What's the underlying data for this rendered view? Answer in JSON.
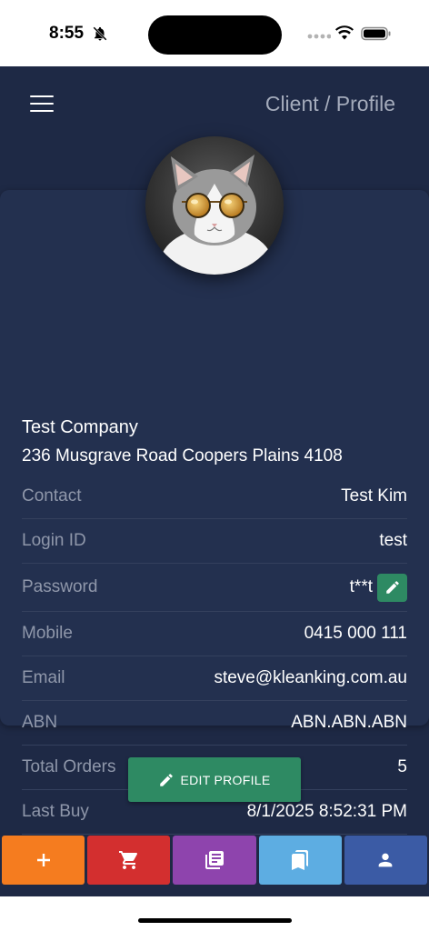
{
  "status_bar": {
    "time": "8:55"
  },
  "header": {
    "title": "Client / Profile"
  },
  "profile": {
    "company": "Test Company",
    "address": "236 Musgrave Road Coopers Plains 4108",
    "fields": [
      {
        "label": "Contact",
        "value": "Test Kim"
      },
      {
        "label": "Login ID",
        "value": "test"
      },
      {
        "label": "Password",
        "value": "t**t"
      },
      {
        "label": "Mobile",
        "value": "0415 000 111"
      },
      {
        "label": "Email",
        "value": "steve@kleanking.com.au"
      },
      {
        "label": "ABN",
        "value": "ABN.ABN.ABN"
      },
      {
        "label": "Total Orders",
        "value": "5"
      },
      {
        "label": "Last Buy",
        "value": "8/1/2025 8:52:31 PM"
      }
    ]
  },
  "actions": {
    "edit_profile_label": "EDIT PROFILE"
  },
  "bottom_nav": {
    "tabs": [
      {
        "icon": "plus-icon",
        "color": "#f57c1f"
      },
      {
        "icon": "cart-icon",
        "color": "#d32f2f"
      },
      {
        "icon": "library-icon",
        "color": "#8e44ad"
      },
      {
        "icon": "bookmarks-icon",
        "color": "#5dade2"
      },
      {
        "icon": "person-icon",
        "color": "#3b5ba5"
      }
    ]
  },
  "colors": {
    "background": "#1e2945",
    "card": "#23304f",
    "accent_green": "#2e8a63",
    "label_gray": "#8f97aa"
  }
}
